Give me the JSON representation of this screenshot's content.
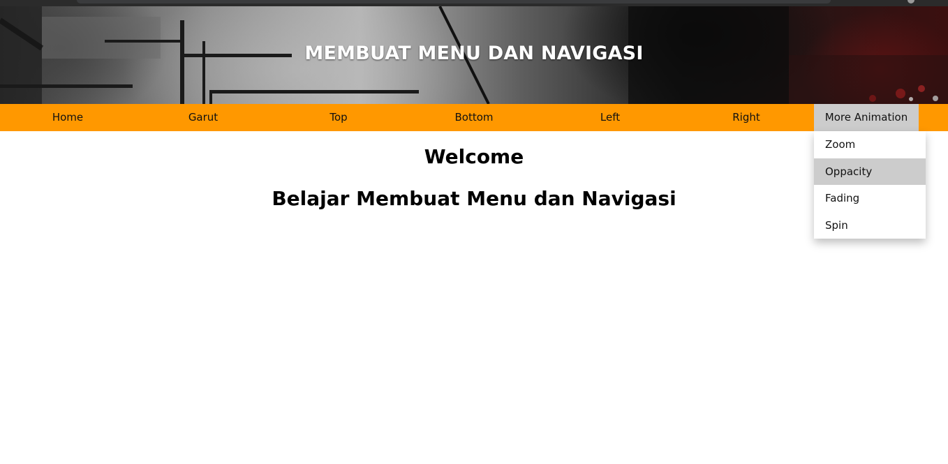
{
  "header": {
    "title": "MEMBUAT MENU DAN NAVIGASI"
  },
  "navbar": {
    "items": [
      {
        "label": "Home"
      },
      {
        "label": "Garut"
      },
      {
        "label": "Top"
      },
      {
        "label": "Bottom"
      },
      {
        "label": "Left"
      },
      {
        "label": "Right"
      },
      {
        "label": "More Animation"
      }
    ],
    "dropdown": {
      "items": [
        {
          "label": "Zoom"
        },
        {
          "label": "Oppacity"
        },
        {
          "label": "Fading"
        },
        {
          "label": "Spin"
        }
      ]
    }
  },
  "main": {
    "heading": "Welcome",
    "subheading": "Belajar Membuat Menu dan Navigasi"
  },
  "colors": {
    "navbar": "#ff9800",
    "active": "#cccccc",
    "title": "#ffffff"
  }
}
